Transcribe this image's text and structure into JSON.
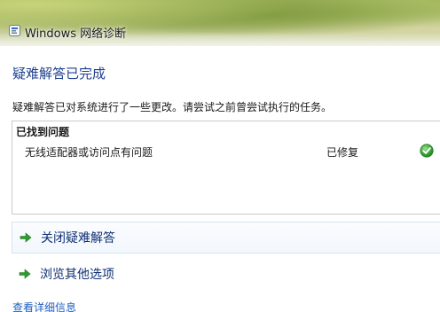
{
  "window": {
    "title": "Windows 网络诊断",
    "title_icon": "network-diagnostics-icon"
  },
  "main": {
    "heading": "疑难解答已完成",
    "description": "疑难解答已对系统进行了一些更改。请尝试之前曾尝试执行的任务。",
    "problems": {
      "header": "已找到问题",
      "items": [
        {
          "text": "无线适配器或访问点有问题",
          "status": "已修复",
          "status_icon": "green-check-icon"
        }
      ]
    },
    "options": [
      {
        "label": "关闭疑难解答",
        "icon": "green-arrow-icon"
      },
      {
        "label": "浏览其他选项",
        "icon": "green-arrow-icon"
      }
    ],
    "details_link": "查看详细信息"
  },
  "colors": {
    "heading": "#1e3f8f",
    "link": "#1f5fbf",
    "arrow": "#2e9b2e",
    "check": "#3aa63a"
  }
}
